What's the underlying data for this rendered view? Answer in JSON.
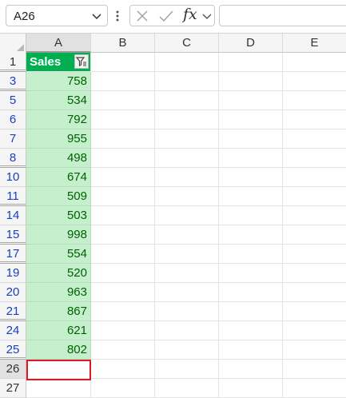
{
  "name_box": {
    "value": "A26",
    "dropdown_icon": "chevron-down-icon"
  },
  "formula_bar": {
    "cancel_icon": "close-icon",
    "enter_icon": "check-icon",
    "function_label": "fx",
    "expand_icon": "chevron-down-icon",
    "value": ""
  },
  "columns": [
    "A",
    "B",
    "C",
    "D",
    "E"
  ],
  "header_cell": {
    "text": "Sales",
    "filter_icon": "filter-active-icon"
  },
  "rows": [
    {
      "row": "1"
    },
    {
      "row": "3",
      "value": "758"
    },
    {
      "row": "5",
      "value": "534"
    },
    {
      "row": "6",
      "value": "792"
    },
    {
      "row": "7",
      "value": "955"
    },
    {
      "row": "8",
      "value": "498"
    },
    {
      "row": "10",
      "value": "674"
    },
    {
      "row": "11",
      "value": "509"
    },
    {
      "row": "14",
      "value": "503"
    },
    {
      "row": "15",
      "value": "998"
    },
    {
      "row": "17",
      "value": "554"
    },
    {
      "row": "19",
      "value": "520"
    },
    {
      "row": "20",
      "value": "963"
    },
    {
      "row": "21",
      "value": "867"
    },
    {
      "row": "24",
      "value": "621"
    },
    {
      "row": "25",
      "value": "802"
    },
    {
      "row": "26"
    },
    {
      "row": "27"
    }
  ],
  "colors": {
    "header_fill": "#00b050",
    "data_fill": "#c6efce",
    "data_text": "#006100",
    "filtered_row_number": "#1a3fbf",
    "active_cell_border": "#d81b24"
  }
}
